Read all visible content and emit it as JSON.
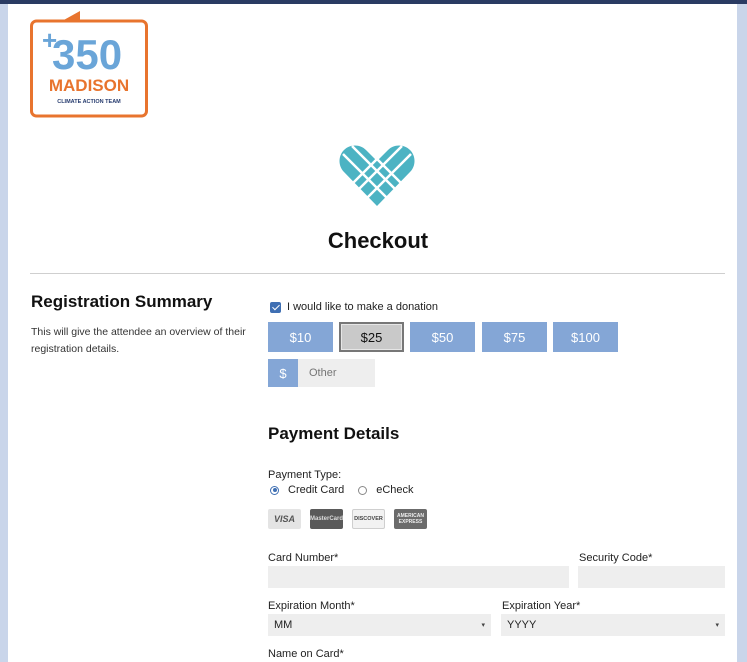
{
  "logo": {
    "number": "350",
    "name": "MADISON",
    "tagline": "CLIMATE ACTION TEAM"
  },
  "page_title": "Checkout",
  "registration": {
    "title": "Registration Summary",
    "description": "This will give the attendee an overview of their registration details."
  },
  "donation": {
    "checkbox_label": "I would like to make a donation",
    "checked": true,
    "amounts": [
      "$10",
      "$25",
      "$50",
      "$75",
      "$100"
    ],
    "selected": "$25",
    "currency_symbol": "$",
    "other_placeholder": "Other"
  },
  "payment": {
    "title": "Payment Details",
    "type_label": "Payment Type:",
    "options": [
      "Credit Card",
      "eCheck"
    ],
    "selected": "Credit Card",
    "cards": {
      "visa": "VISA",
      "mastercard": "MasterCard",
      "discover": "DISCOVER",
      "amex_line1": "AMERICAN",
      "amex_line2": "EXPRESS"
    },
    "card_number_label": "Card Number*",
    "security_code_label": "Security Code*",
    "exp_month_label": "Expiration Month*",
    "exp_month_value": "MM",
    "exp_year_label": "Expiration Year*",
    "exp_year_value": "YYYY",
    "name_on_card_label": "Name on Card*"
  },
  "colors": {
    "accent_blue": "#84a6d6",
    "logo_orange": "#e8742e",
    "logo_navy": "#263b6e",
    "logo_light_blue": "#6aa5d8",
    "heart_teal": "#4cb3c3"
  }
}
